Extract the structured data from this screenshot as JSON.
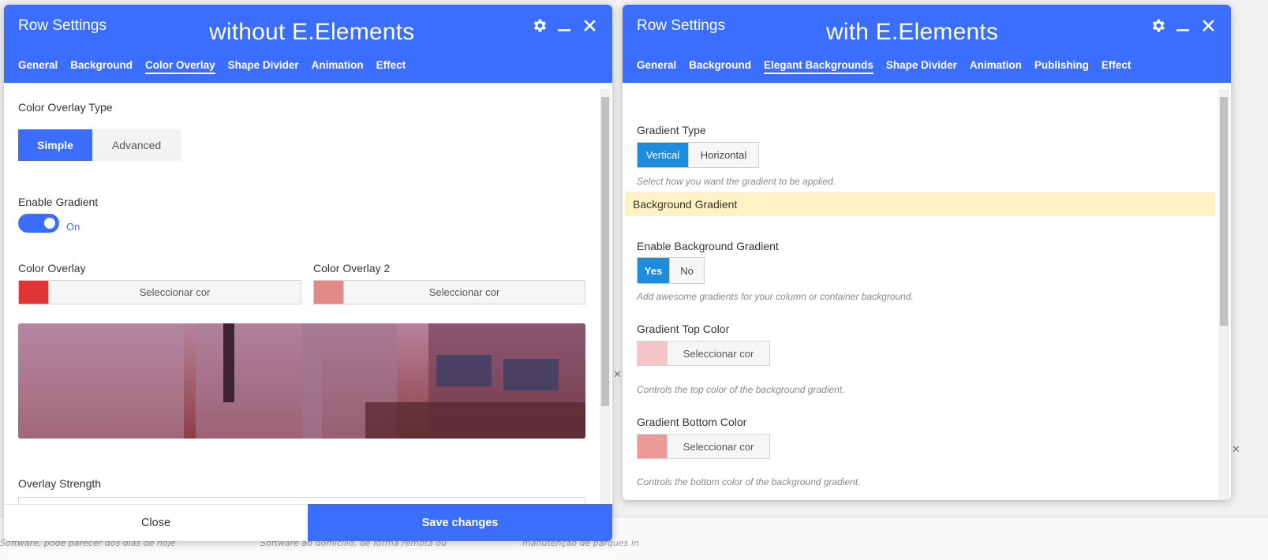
{
  "background": {
    "texts": [
      "Software, pode parecer dos dias de hoje",
      "Software ao domicílio, de forma remota ou",
      "manutenção de parques in"
    ]
  },
  "left": {
    "title": "Row Settings",
    "caption": "without E.Elements",
    "tabs": [
      "General",
      "Background",
      "Color Overlay",
      "Shape Divider",
      "Animation",
      "Effect"
    ],
    "active_tab": "Color Overlay",
    "color_overlay_type": {
      "label": "Color Overlay Type",
      "options": [
        "Simple",
        "Advanced"
      ],
      "selected": "Simple"
    },
    "enable_gradient": {
      "label": "Enable Gradient",
      "state": "On"
    },
    "color_overlay": {
      "label": "Color Overlay",
      "button": "Seleccionar cor",
      "color": "#e03535"
    },
    "color_overlay_2": {
      "label": "Color Overlay 2",
      "button": "Seleccionar cor",
      "color": "#e08a88"
    },
    "overlay_strength": {
      "label": "Overlay Strength"
    },
    "footer": {
      "close": "Close",
      "save": "Save changes"
    }
  },
  "right": {
    "title": "Row Settings",
    "caption": "with E.Elements",
    "tabs": [
      "General",
      "Background",
      "Elegant Backgrounds",
      "Shape Divider",
      "Animation",
      "Publishing",
      "Effect"
    ],
    "active_tab": "Elegant Backgrounds",
    "gradient_type": {
      "label": "Gradient Type",
      "options": [
        "Vertical",
        "Horizontal"
      ],
      "selected": "Vertical",
      "hint": "Select how you want the gradient to be applied."
    },
    "section": "Background Gradient",
    "enable_bg_gradient": {
      "label": "Enable Background Gradient",
      "options": [
        "Yes",
        "No"
      ],
      "selected": "Yes",
      "hint": "Add awesome gradients for your column or container background."
    },
    "top_color": {
      "label": "Gradient Top Color",
      "button": "Seleccionar cor",
      "color": "#f5c4c4",
      "hint": "Controls the top color of the background gradient."
    },
    "bottom_color": {
      "label": "Gradient Bottom Color",
      "button": "Seleccionar cor",
      "color": "#ec9a98",
      "hint": "Controls the bottom color of the background gradient."
    }
  },
  "colors": {
    "header": "#3b6efe",
    "active_primary": "#3b6efe",
    "active_secondary": "#1e8cdc",
    "section_bg": "#fff2c5"
  }
}
